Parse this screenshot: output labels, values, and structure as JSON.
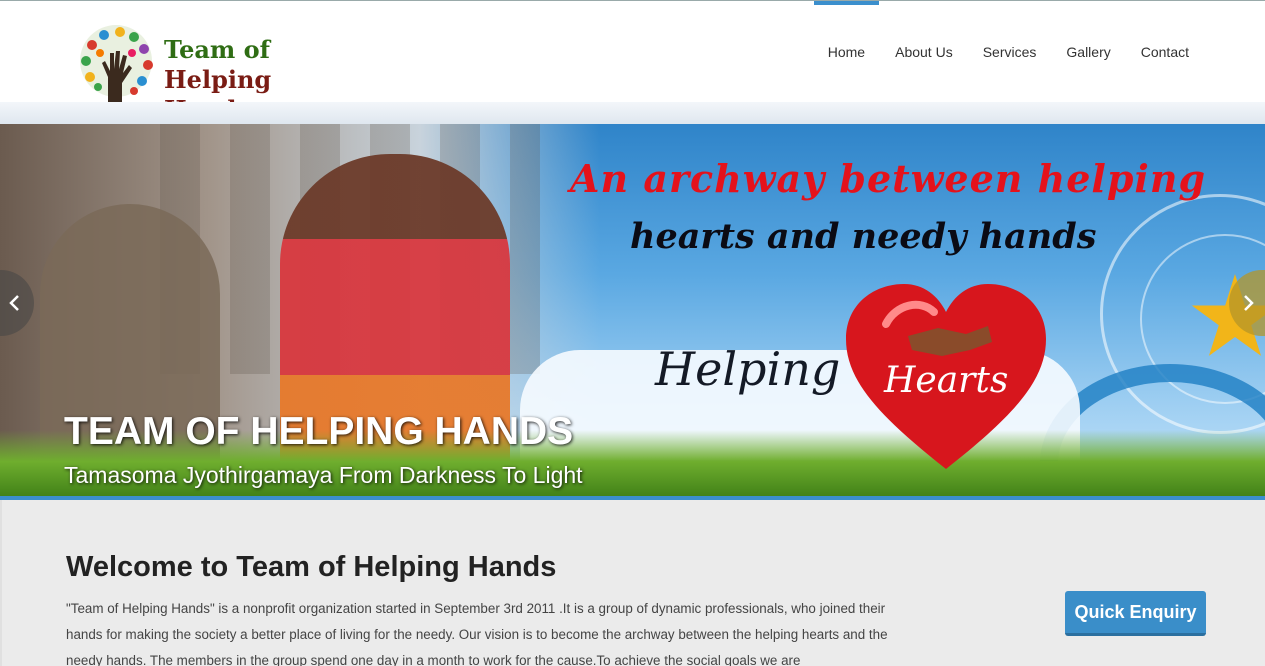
{
  "brand": {
    "line1": "Team of",
    "line2": "Helping Hands"
  },
  "nav": {
    "items": [
      {
        "label": "Home",
        "active": true
      },
      {
        "label": "About Us"
      },
      {
        "label": "Services"
      },
      {
        "label": "Gallery"
      },
      {
        "label": "Contact"
      }
    ]
  },
  "slider": {
    "tagline_line1": "An archway between helping",
    "tagline_line2": "hearts and needy hands",
    "helping": "Helping",
    "hearts": "Hearts",
    "title": "TEAM OF HELPING HANDS",
    "subtitle": "Tamasoma Jyothirgamaya From Darkness To Light",
    "prev_icon": "chevron-left-icon",
    "next_icon": "chevron-right-icon"
  },
  "welcome": {
    "heading": "Welcome to Team of Helping Hands",
    "body": "\"Team of Helping Hands\" is a nonprofit organization started in September 3rd 2011 .It is a group of dynamic professionals, who joined their hands for making the society a better place of living for the needy. Our vision is to become the archway between the helping hearts and the needy hands. The members in the group spend one day in a month to work for the cause.To achieve the social goals we are",
    "enquiry_label": "Quick Enquiry"
  },
  "colors": {
    "accent": "#3b8fcd",
    "brand_green": "#2f6d14",
    "brand_red": "#7a1c14",
    "tagline_red": "#e4121b"
  }
}
